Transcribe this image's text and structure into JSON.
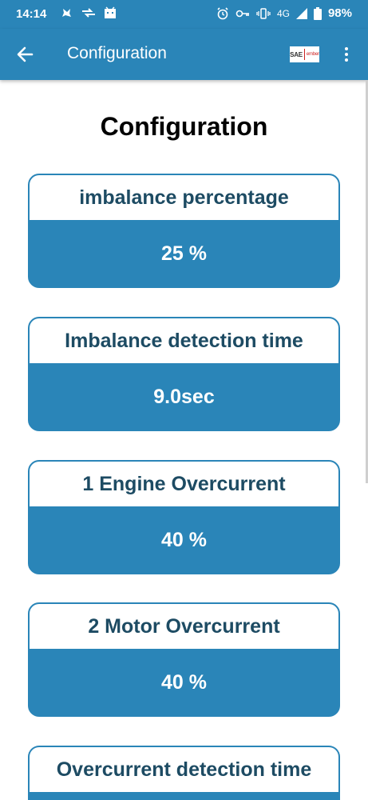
{
  "status_bar": {
    "time": "14:14",
    "network": "4G",
    "battery": "98%"
  },
  "app_bar": {
    "title": "Configuration",
    "logo_text": "SAE",
    "logo_small": "ember"
  },
  "page": {
    "title": "Configuration"
  },
  "cards": [
    {
      "label": "imbalance percentage",
      "value": "25 %"
    },
    {
      "label": "Imbalance detection time",
      "value": "9.0sec"
    },
    {
      "label": "1 Engine Overcurrent",
      "value": "40 %"
    },
    {
      "label": "2 Motor Overcurrent",
      "value": "40 %"
    },
    {
      "label": "Overcurrent detection time",
      "value": ""
    }
  ],
  "colors": {
    "primary": "#2a85b8",
    "heading_text": "#1d4b63"
  }
}
